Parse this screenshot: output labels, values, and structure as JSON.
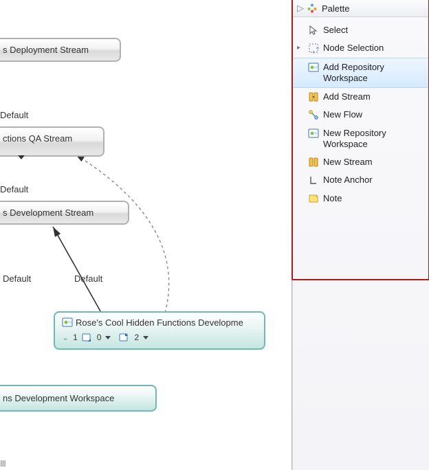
{
  "canvas": {
    "nodes": {
      "deploy_stream": {
        "label": "s Deployment Stream"
      },
      "qa_stream": {
        "label": "ctions QA Stream"
      },
      "dev_stream": {
        "label": "s Development Stream"
      },
      "rose_ws": {
        "label": "Rose's Cool Hidden Functions Developme",
        "counts": {
          "expand": "1",
          "incoming": "0",
          "outgoing": "2"
        }
      },
      "ns_dev_ws": {
        "label": "ns Development Workspace"
      }
    },
    "edge_labels": {
      "e1": "Default",
      "e2": "Default",
      "e3": "Default",
      "e4": "Default"
    },
    "scroll_hint": "III"
  },
  "palette": {
    "title": "Palette",
    "items": [
      {
        "key": "select",
        "label": "Select",
        "icon": "cursor-icon",
        "expandable": false,
        "selected": false
      },
      {
        "key": "node-sel",
        "label": "Node Selection",
        "icon": "node-selection-icon",
        "expandable": true,
        "selected": false
      },
      {
        "key": "add-repo-ws",
        "label": "Add Repository Workspace",
        "icon": "workspace-icon",
        "expandable": false,
        "selected": true
      },
      {
        "key": "add-stream",
        "label": "Add Stream",
        "icon": "add-stream-icon",
        "expandable": false,
        "selected": false
      },
      {
        "key": "new-flow",
        "label": "New Flow",
        "icon": "flow-icon",
        "expandable": false,
        "selected": false
      },
      {
        "key": "new-repo-ws",
        "label": "New Repository Workspace",
        "icon": "workspace-icon",
        "expandable": false,
        "selected": false
      },
      {
        "key": "new-stream",
        "label": "New Stream",
        "icon": "new-stream-icon",
        "expandable": false,
        "selected": false
      },
      {
        "key": "note-anchor",
        "label": "Note Anchor",
        "icon": "note-anchor-icon",
        "expandable": false,
        "selected": false
      },
      {
        "key": "note",
        "label": "Note",
        "icon": "note-icon",
        "expandable": false,
        "selected": false
      }
    ]
  }
}
